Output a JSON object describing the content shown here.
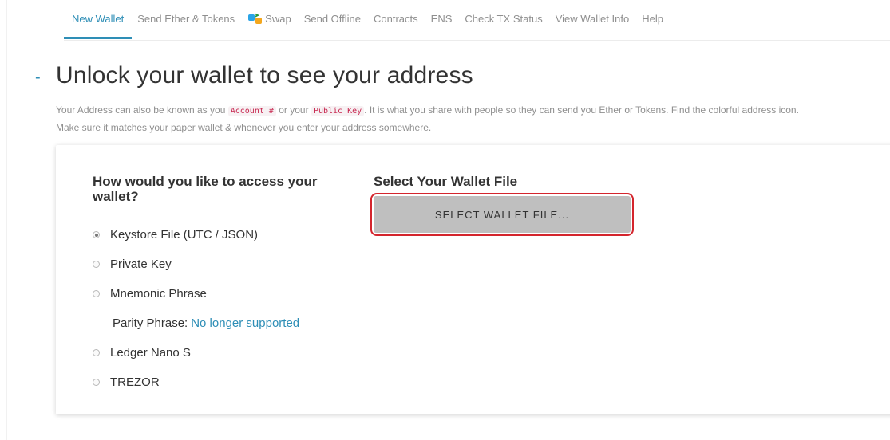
{
  "nav": {
    "items": [
      {
        "label": "New Wallet",
        "active": true
      },
      {
        "label": "Send Ether & Tokens"
      },
      {
        "label": "Swap",
        "icon": "swap-icon"
      },
      {
        "label": "Send Offline"
      },
      {
        "label": "Contracts"
      },
      {
        "label": "ENS"
      },
      {
        "label": "Check TX Status"
      },
      {
        "label": "View Wallet Info"
      },
      {
        "label": "Help"
      }
    ]
  },
  "header": {
    "dash": "-",
    "title": "Unlock your wallet to see your address",
    "desc_line1_a": "Your Address can also be known as you",
    "code1": "Account #",
    "desc_line1_b": "or your",
    "code2": "Public Key",
    "desc_line1_c": ". It is what you share with people so they can send you Ether or Tokens. Find the colorful address icon.",
    "desc_line2": "Make sure it matches your paper wallet & whenever you enter your address somewhere."
  },
  "access": {
    "question": "How would you like to access your wallet?",
    "options": [
      {
        "label": "Keystore File (UTC / JSON)",
        "checked": true
      },
      {
        "label": "Private Key",
        "checked": false
      },
      {
        "label": "Mnemonic Phrase",
        "checked": false
      }
    ],
    "parity_label": "Parity Phrase:",
    "parity_link": "No longer supported",
    "options2": [
      {
        "label": "Ledger Nano S",
        "checked": false
      },
      {
        "label": "TREZOR",
        "checked": false
      }
    ]
  },
  "file": {
    "title": "Select Your Wallet File",
    "button_label": "SELECT WALLET FILE..."
  },
  "colors": {
    "accent": "#2e8eb6",
    "highlight_outline": "#d4252d",
    "button_bg": "#bfbfbf"
  }
}
